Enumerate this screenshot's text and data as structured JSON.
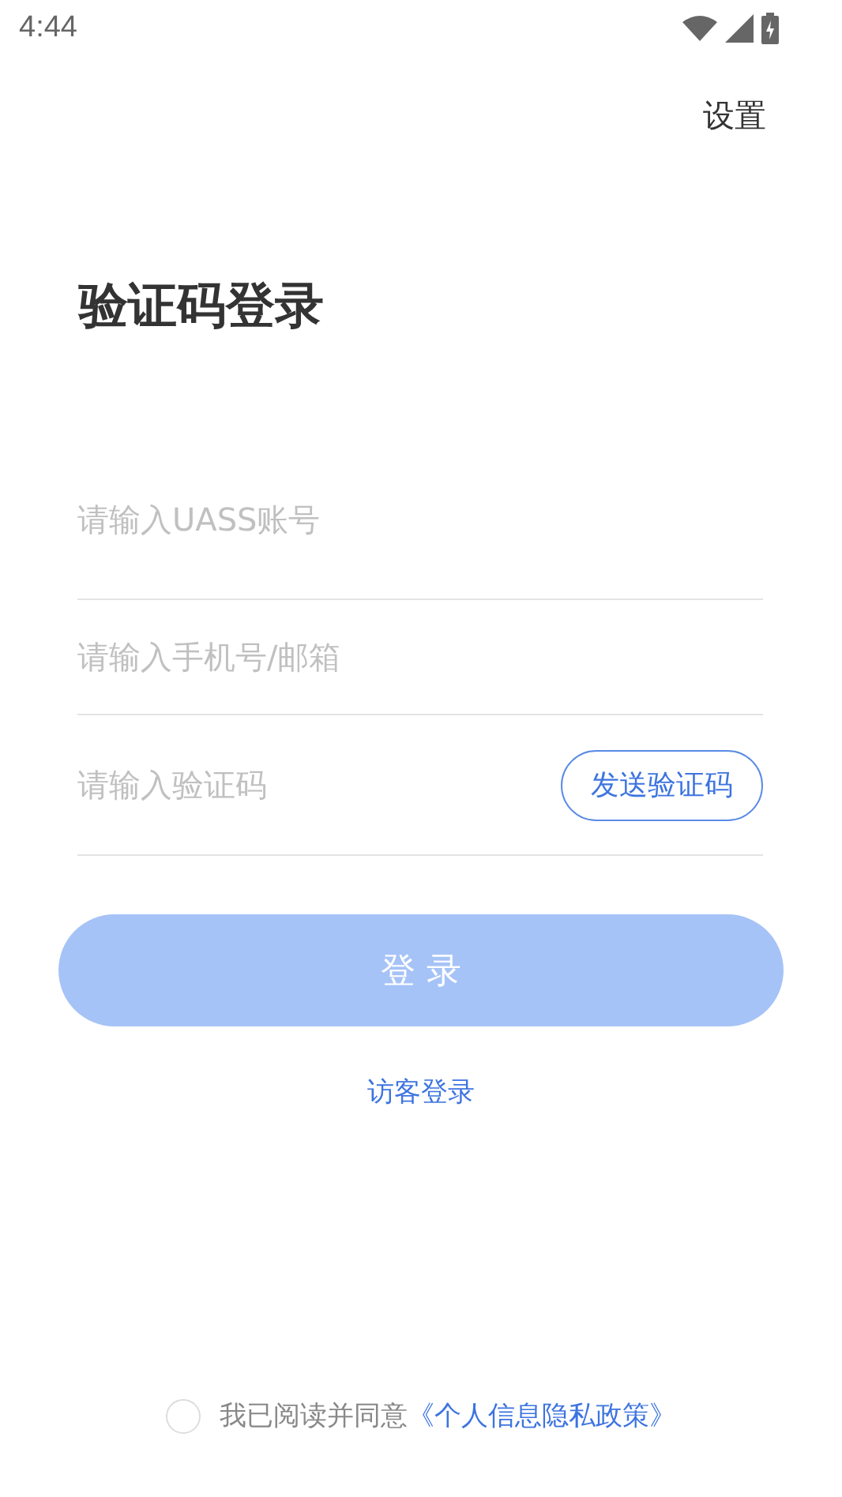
{
  "status_bar": {
    "time": "4:44"
  },
  "settings": "设置",
  "title": "验证码登录",
  "fields": [
    {
      "kind": "text",
      "placeholder": "请输入UASS账号"
    },
    {
      "kind": "text",
      "placeholder": "请输入手机号/邮箱"
    },
    {
      "kind": "code",
      "placeholder": "请输入验证码",
      "button": "发送验证码"
    }
  ],
  "login_button": {
    "label": "登 录",
    "disabled": true
  },
  "guest_link": "访客登录",
  "agreement": {
    "checked": false,
    "text": "我已阅读并同意",
    "link": "《个人信息隐私政策》"
  }
}
